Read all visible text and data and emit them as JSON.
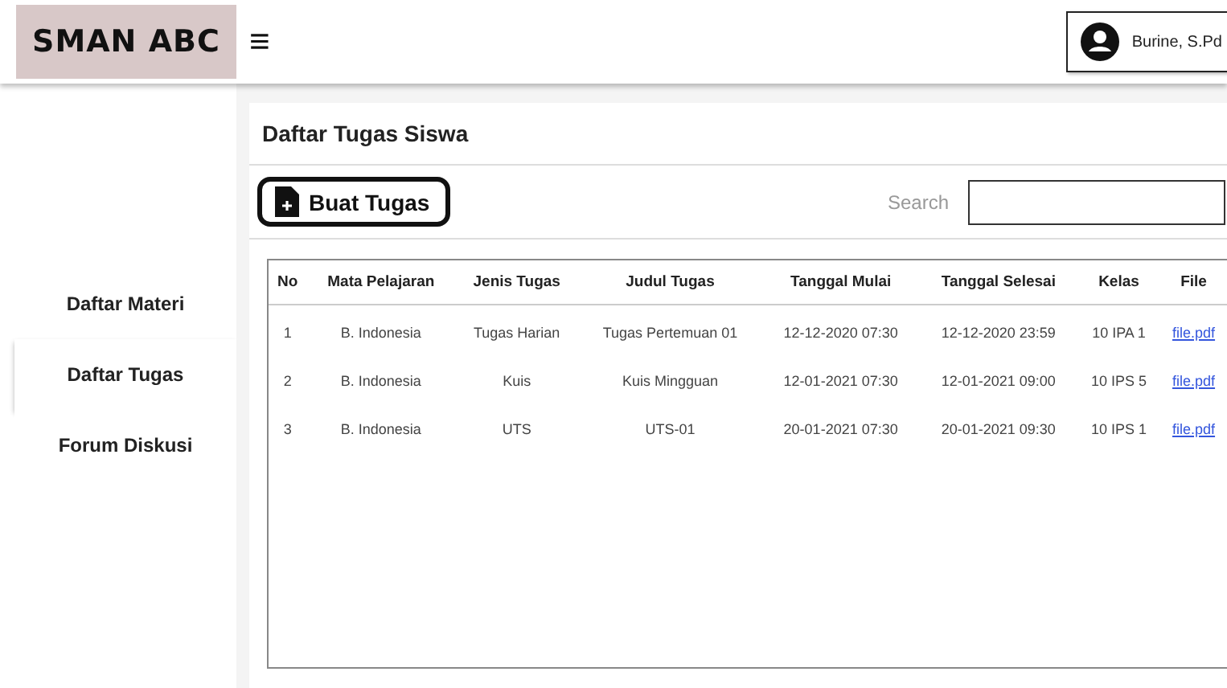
{
  "header": {
    "logo": "SMAN ABC",
    "menu_icon": "≡",
    "user": {
      "name": "Burine, S.Pd"
    }
  },
  "sidebar": {
    "items": [
      {
        "label": "Daftar Materi",
        "selected": false
      },
      {
        "label": "Daftar Tugas",
        "selected": true
      },
      {
        "label": "Forum Diskusi",
        "selected": false
      }
    ]
  },
  "page": {
    "title": "Daftar Tugas Siswa",
    "create_button": "Buat Tugas",
    "search": {
      "label": "Search"
    }
  },
  "table": {
    "columns": [
      "No",
      "Mata Pelajaran",
      "Jenis Tugas",
      "Judul Tugas",
      "Tanggal Mulai",
      "Tanggal Selesai",
      "Kelas",
      "File"
    ],
    "rows": [
      [
        "1",
        "B. Indonesia",
        "Tugas Harian",
        "Tugas Pertemuan 01",
        "12-12-2020 07:30",
        "12-12-2020 23:59",
        "10 IPA 1",
        "file.pdf"
      ],
      [
        "2",
        "B. Indonesia",
        "Kuis",
        "Kuis Mingguan",
        "12-01-2021 07:30",
        "12-01-2021 09:00",
        "10 IPS 5",
        "file.pdf"
      ],
      [
        "3",
        "B. Indonesia",
        "UTS",
        "UTS-01",
        "20-01-2021 07:30",
        "20-01-2021 09:30",
        "10 IPS 1",
        "file.pdf"
      ]
    ]
  }
}
